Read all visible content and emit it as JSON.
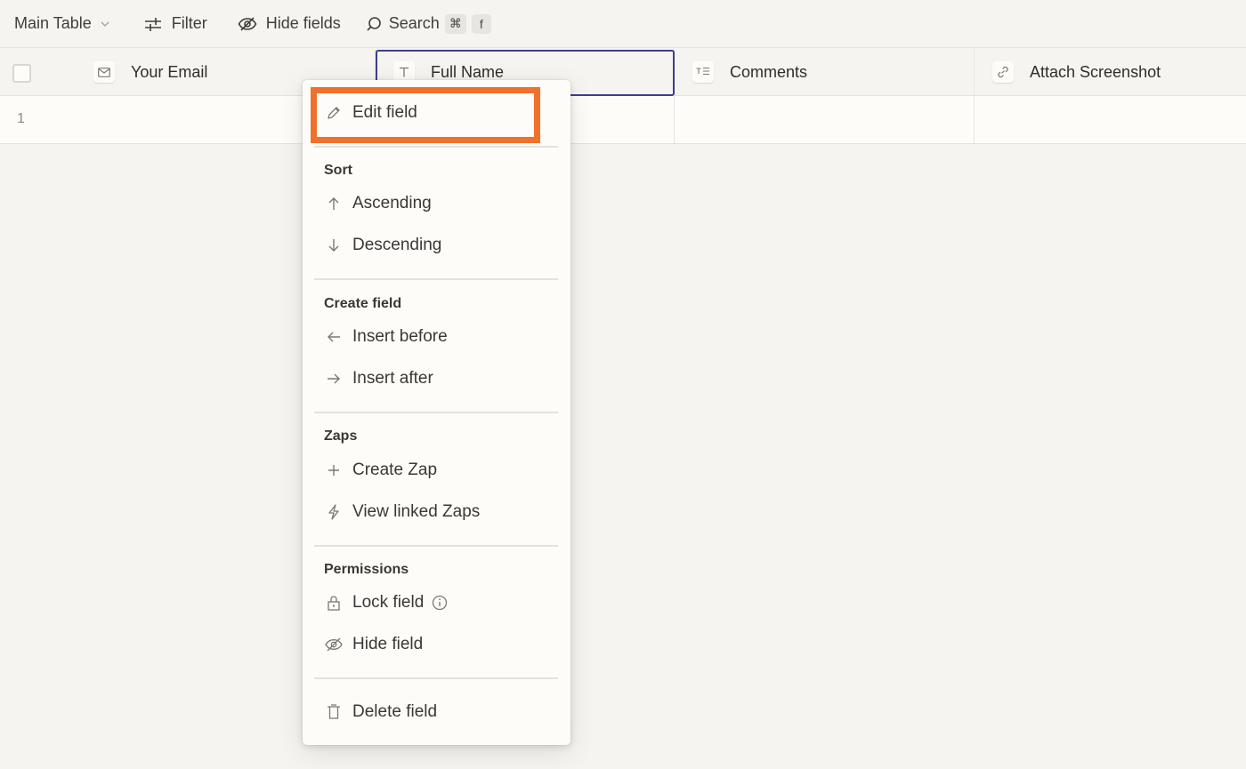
{
  "toolbar": {
    "view_name": "Main Table",
    "filter_label": "Filter",
    "hide_fields_label": "Hide fields",
    "search_label": "Search",
    "search_shortcut_keys": [
      "⌘",
      "f"
    ]
  },
  "table": {
    "columns": [
      {
        "name": "Your Email",
        "icon": "email-icon"
      },
      {
        "name": "Full Name",
        "icon": "text-icon",
        "selected": true
      },
      {
        "name": "Comments",
        "icon": "long-text-icon"
      },
      {
        "name": "Attach Screenshot",
        "icon": "attachment-icon"
      }
    ],
    "rows": [
      {
        "number": "1",
        "cells": [
          "",
          "",
          "",
          ""
        ]
      }
    ]
  },
  "context_menu": {
    "highlight_color": "#f0702c",
    "selected_column_border_color": "#3b3f8f",
    "items": {
      "edit_field": "Edit field",
      "sort_heading": "Sort",
      "ascending": "Ascending",
      "descending": "Descending",
      "create_field_heading": "Create field",
      "insert_before": "Insert before",
      "insert_after": "Insert after",
      "zaps_heading": "Zaps",
      "create_zap": "Create Zap",
      "view_linked_zaps": "View linked Zaps",
      "permissions_heading": "Permissions",
      "lock_field": "Lock field",
      "hide_field": "Hide field",
      "delete_field": "Delete field"
    }
  }
}
